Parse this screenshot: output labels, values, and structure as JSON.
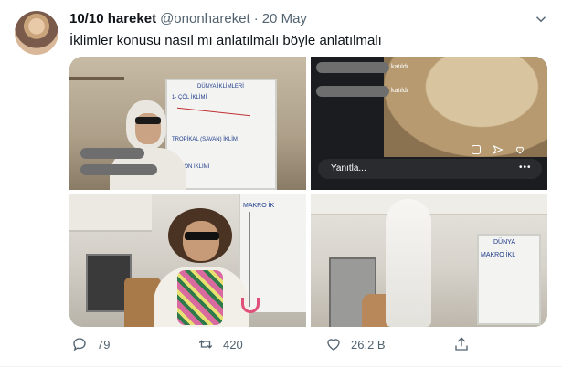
{
  "tweet": {
    "author_name": "10/10 hareket",
    "handle": "@ononhareket",
    "separator": "·",
    "date": "20 May",
    "text": "İklimler konusu nasıl mı anlatılmalı böyle anlatılmalı"
  },
  "media": {
    "cell1": {
      "board_title": "DÜNYA İKLİMLERİ",
      "board_lines": [
        "1- ÇÖL İKLİMİ",
        "TROPİKAL (SAVAN) İKLİM",
        "MUSON İKLİMİ"
      ]
    },
    "cell2": {
      "joined_1": "katıldı",
      "joined_2": "katıldı",
      "reply_placeholder": "Yanıtla...",
      "more": "•••"
    },
    "cell3": {
      "board_text": "MAKRO İK"
    },
    "cell4": {
      "board_title": "DÜNYA",
      "board_line": "MAKRO İKL"
    }
  },
  "actions": {
    "replies": "79",
    "retweets": "420",
    "likes": "26,2 B"
  },
  "colors": {
    "text_primary": "#0f1419",
    "text_secondary": "#536471",
    "background": "#ffffff"
  },
  "icons": [
    "chevron-down-icon",
    "reply-icon",
    "retweet-icon",
    "like-icon",
    "share-icon",
    "instagram-dm-icon",
    "instagram-send-icon",
    "instagram-heart-icon"
  ]
}
